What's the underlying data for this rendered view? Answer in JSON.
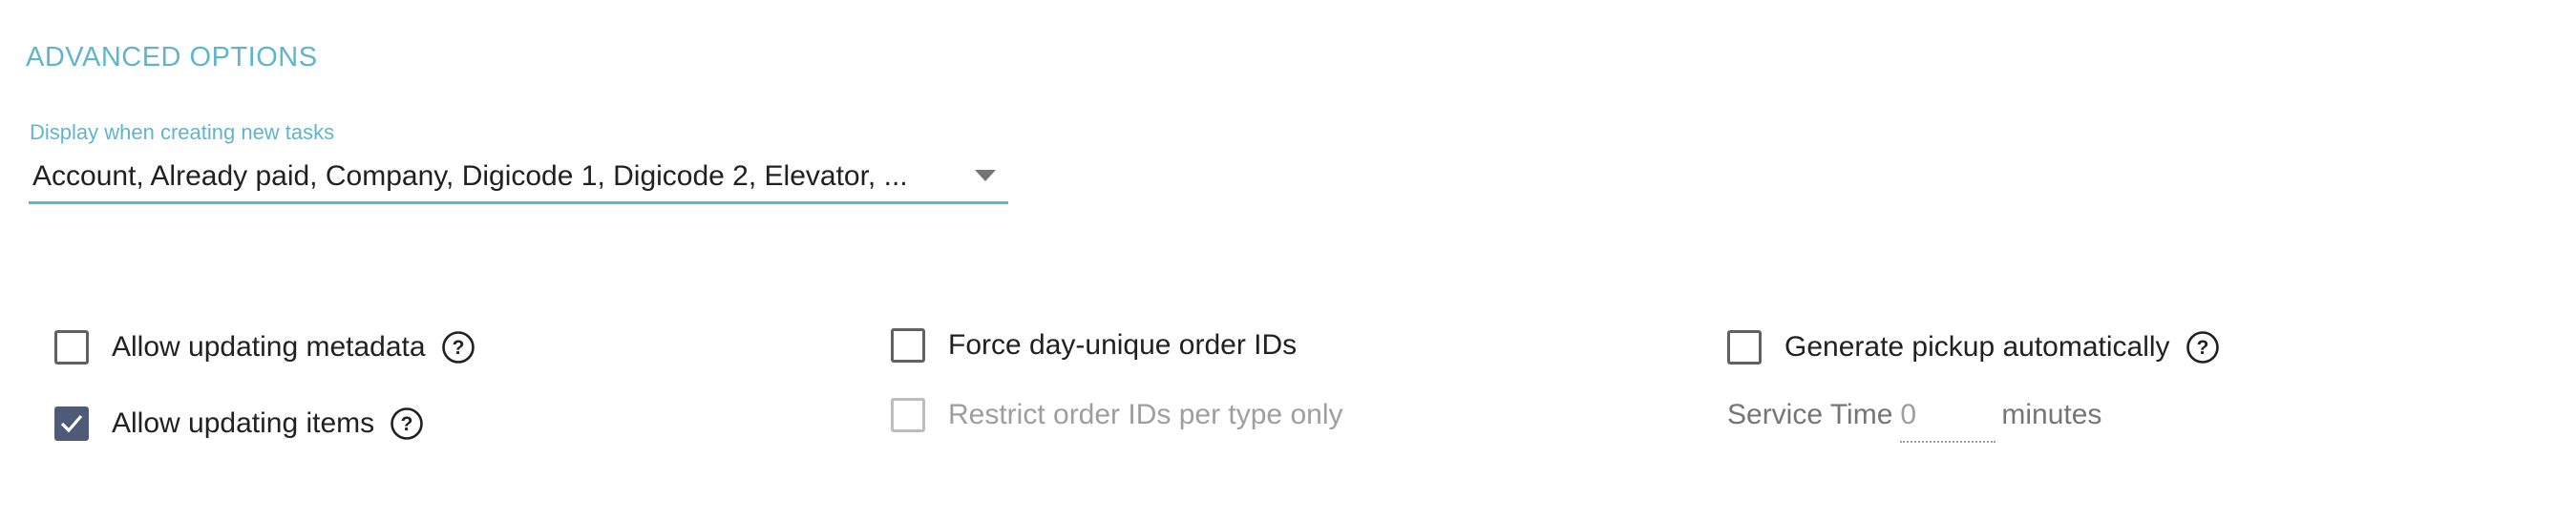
{
  "section": {
    "title": "ADVANCED OPTIONS"
  },
  "display_field": {
    "label": "Display when creating new tasks",
    "value": "Account, Already paid, Company, Digicode 1, Digicode 2, Elevator, ..."
  },
  "options": {
    "allow_updating_metadata": {
      "label": "Allow updating metadata",
      "checked": false
    },
    "allow_updating_items": {
      "label": "Allow updating items",
      "checked": true
    },
    "force_day_unique_order_ids": {
      "label": "Force day-unique order IDs",
      "checked": false
    },
    "restrict_order_ids_per_type": {
      "label": "Restrict order IDs per type only",
      "checked": false,
      "disabled": true
    },
    "generate_pickup_automatically": {
      "label": "Generate pickup automatically",
      "checked": false
    }
  },
  "service_time": {
    "label": "Service Time",
    "placeholder": "0",
    "unit": "minutes"
  },
  "icons": {
    "help": "help-circle-icon",
    "dropdown": "caret-down-icon",
    "check": "check-icon"
  },
  "colors": {
    "accent": "#5fb6cc",
    "checkbox_checked": "#4d5b78",
    "text": "#212121",
    "disabled": "#9e9e9e"
  }
}
